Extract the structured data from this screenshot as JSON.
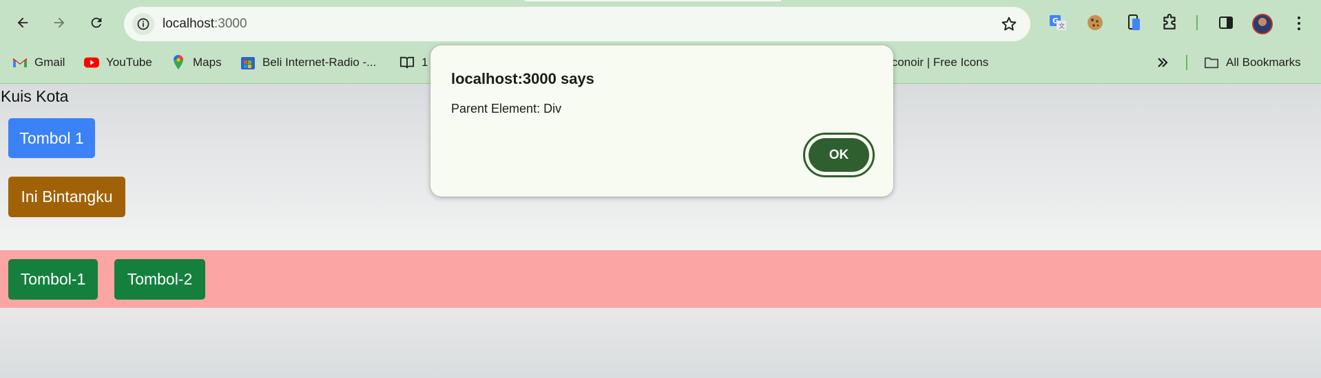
{
  "browser": {
    "url_host": "localhost",
    "url_port": ":3000",
    "bookmarks": [
      {
        "label": "Gmail",
        "icon": "gmail-icon"
      },
      {
        "label": "YouTube",
        "icon": "youtube-icon"
      },
      {
        "label": "Maps",
        "icon": "maps-icon"
      },
      {
        "label": "Beli Internet-Radio -...",
        "icon": "store-icon"
      },
      {
        "label": "1",
        "icon": "book-icon"
      },
      {
        "label": "Iconoir | Free Icons",
        "icon": "iconoir-icon"
      }
    ],
    "all_bookmarks_label": "All Bookmarks",
    "colors": {
      "frame": "#c6e2c6",
      "accent": "#2f5e2f"
    }
  },
  "page": {
    "title": "Kuis Kota",
    "buttons": {
      "tombol1": "Tombol 1",
      "bintang": "Ini Bintangku",
      "tombol_dash_1": "Tombol-1",
      "tombol_dash_2": "Tombol-2"
    },
    "colors": {
      "blue": "#3b82f6",
      "amber": "#a16207",
      "green": "#15803d",
      "pink": "#fba5a5"
    }
  },
  "dialog": {
    "title": "localhost:3000 says",
    "message": "Parent Element: Div",
    "ok_label": "OK"
  }
}
